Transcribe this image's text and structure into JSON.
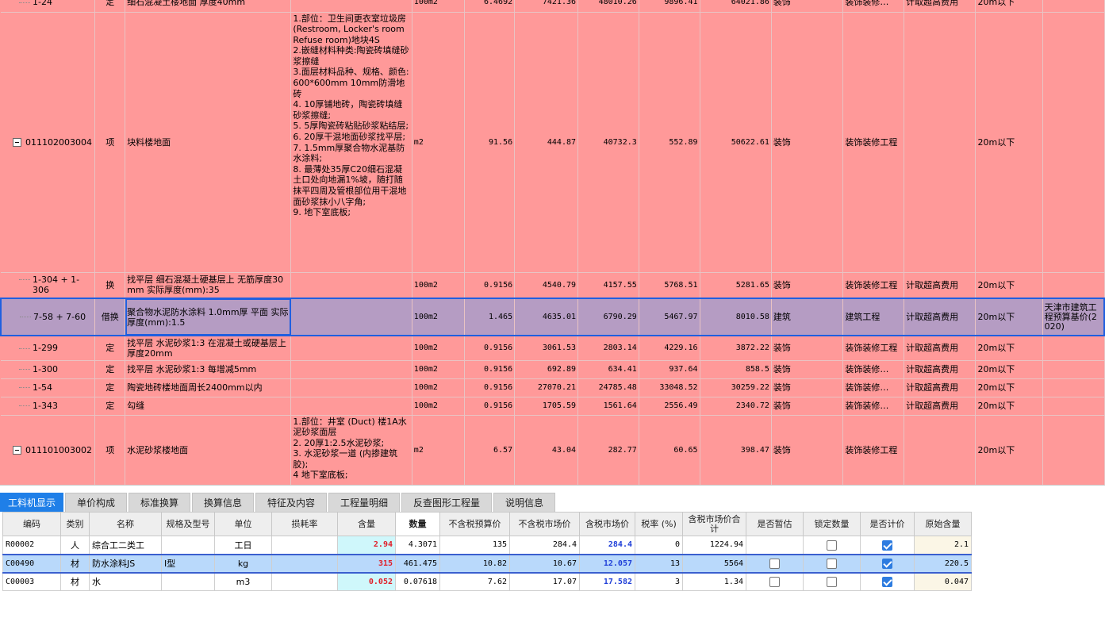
{
  "upper_rows": [
    {
      "code": "1-24",
      "type": "定",
      "name": "细石混凝土楼地面 厚度40mm",
      "desc": "",
      "unit": "100m2",
      "qty": "6.4692",
      "p1": "7421.36",
      "p2": "48010.26",
      "p3": "9896.41",
      "p4": "64021.86",
      "major": "装饰",
      "category": "装饰装修…",
      "fee": "计取超高费用",
      "height": "20m以下",
      "std": ""
    },
    {
      "code": "011102003004",
      "type": "项",
      "name": "块料楼地面",
      "desc": "1.部位：卫生间更衣室垃圾房 (Restroom, Locker's room Refuse room)地块4S\n2.嵌缝材料种类:陶瓷砖填缝砂浆擦缝\n3.面层材料品种、规格、颜色:600*600mm 10mm防滑地砖\n4. 10厚铺地砖，陶瓷砖填缝砂浆擦缝;\n5. 5厚陶瓷砖粘贴砂浆粘结层;\n6. 20厚干混地面砂浆找平层;\n7. 1.5mm厚聚合物水泥基防水涂料;\n8. 最薄处35厚C20细石混凝土口处向地漏1%坡，随打随抹平四周及管根部位用干混地面砂浆抹小八字角;\n9. 地下室底板;",
      "unit": "m2",
      "qty": "91.56",
      "p1": "444.87",
      "p2": "40732.3",
      "p3": "552.89",
      "p4": "50622.61",
      "major": "装饰",
      "category": "装饰装修工程",
      "fee": "",
      "height": "20m以下",
      "std": ""
    },
    {
      "code": "1-304 + 1-306",
      "type": "换",
      "name": "找平层 细石混凝土硬基层上 无筋厚度30mm  实际厚度(mm):35",
      "desc": "",
      "unit": "100m2",
      "qty": "0.9156",
      "p1": "4540.79",
      "p2": "4157.55",
      "p3": "5768.51",
      "p4": "5281.65",
      "major": "装饰",
      "category": "装饰装修工程",
      "fee": "计取超高费用",
      "height": "20m以下",
      "std": ""
    },
    {
      "code": "7-58 + 7-60",
      "type": "借换",
      "name": "聚合物水泥防水涂料 1.0mm厚 平面  实际厚度(mm):1.5",
      "desc": "",
      "unit": "100m2",
      "qty": "1.465",
      "p1": "4635.01",
      "p2": "6790.29",
      "p3": "5467.97",
      "p4": "8010.58",
      "major": "建筑",
      "category": "建筑工程",
      "fee": "计取超高费用",
      "height": "20m以下",
      "std": "天津市建筑工程预算基价(2020)"
    },
    {
      "code": "1-299",
      "type": "定",
      "name": "找平层 水泥砂浆1:3 在混凝土或硬基层上厚度20mm",
      "desc": "",
      "unit": "100m2",
      "qty": "0.9156",
      "p1": "3061.53",
      "p2": "2803.14",
      "p3": "4229.16",
      "p4": "3872.22",
      "major": "装饰",
      "category": "装饰装修工程",
      "fee": "计取超高费用",
      "height": "20m以下",
      "std": ""
    },
    {
      "code": "1-300",
      "type": "定",
      "name": "找平层 水泥砂浆1:3 每增减5mm",
      "desc": "",
      "unit": "100m2",
      "qty": "0.9156",
      "p1": "692.89",
      "p2": "634.41",
      "p3": "937.64",
      "p4": "858.5",
      "major": "装饰",
      "category": "装饰装修…",
      "fee": "计取超高费用",
      "height": "20m以下",
      "std": ""
    },
    {
      "code": "1-54",
      "type": "定",
      "name": "陶瓷地砖楼地面周长2400mm以内",
      "desc": "",
      "unit": "100m2",
      "qty": "0.9156",
      "p1": "27070.21",
      "p2": "24785.48",
      "p3": "33048.52",
      "p4": "30259.22",
      "major": "装饰",
      "category": "装饰装修…",
      "fee": "计取超高费用",
      "height": "20m以下",
      "std": ""
    },
    {
      "code": "1-343",
      "type": "定",
      "name": "勾缝",
      "desc": "",
      "unit": "100m2",
      "qty": "0.9156",
      "p1": "1705.59",
      "p2": "1561.64",
      "p3": "2556.49",
      "p4": "2340.72",
      "major": "装饰",
      "category": "装饰装修…",
      "fee": "计取超高费用",
      "height": "20m以下",
      "std": ""
    },
    {
      "code": "011101003002",
      "type": "项",
      "name": "水泥砂浆楼地面",
      "desc": "1.部位：井室 (Duct) 楼1A水泥砂浆面层\n2. 20厚1:2.5水泥砂浆;\n3. 水泥砂浆一道 (内掺建筑胶);\n4 地下室底板;",
      "unit": "m2",
      "qty": "6.57",
      "p1": "43.04",
      "p2": "282.77",
      "p3": "60.65",
      "p4": "398.47",
      "major": "装饰",
      "category": "装饰装修工程",
      "fee": "",
      "height": "20m以下",
      "std": ""
    }
  ],
  "tabs": [
    "工料机显示",
    "单价构成",
    "标准换算",
    "换算信息",
    "特征及内容",
    "工程量明细",
    "反查图形工程量",
    "说明信息"
  ],
  "lower_headers": [
    "编码",
    "类别",
    "名称",
    "规格及型号",
    "单位",
    "损耗率",
    "含量",
    "数量",
    "不含税预算价",
    "不含税市场价",
    "含税市场价",
    "税率 (%)",
    "含税市场价合计",
    "是否暂估",
    "锁定数量",
    "是否计价",
    "原始含量"
  ],
  "lower_rows": [
    {
      "code": "R00002",
      "type": "人",
      "name": "综合工二类工",
      "spec": "",
      "unit": "工日",
      "loss": "",
      "content": "2.94",
      "qty": "4.3071",
      "p1": "135",
      "p2": "284.4",
      "p3": "284.4",
      "tax": "0",
      "total": "1224.94",
      "orig": "2.1"
    },
    {
      "code": "C00490",
      "type": "材",
      "name": "防水涂料JS",
      "spec": "I型",
      "unit": "kg",
      "loss": "",
      "content": "315",
      "qty": "461.475",
      "p1": "10.82",
      "p2": "10.67",
      "p3": "12.057",
      "tax": "13",
      "total": "5564",
      "orig": "220.5"
    },
    {
      "code": "C00003",
      "type": "材",
      "name": "水",
      "spec": "",
      "unit": "m3",
      "loss": "",
      "content": "0.052",
      "qty": "0.07618",
      "p1": "7.62",
      "p2": "17.07",
      "p3": "17.582",
      "tax": "3",
      "total": "1.34",
      "orig": "0.047"
    }
  ],
  "lower_checks": [
    {
      "estimate": false,
      "lock": false,
      "price": true
    },
    {
      "estimate": false,
      "lock": false,
      "price": true
    },
    {
      "estimate": false,
      "lock": false,
      "price": true
    }
  ],
  "colors": {
    "row_bg": "#ff9999",
    "selected_row": "#b59cc3",
    "selection_border": "#1f5fe0",
    "active_tab": "#1f7fe8",
    "lower_selected": "#b9d9fb",
    "qty_red": "#e0202a",
    "price_blue": "#1f3fd8"
  }
}
